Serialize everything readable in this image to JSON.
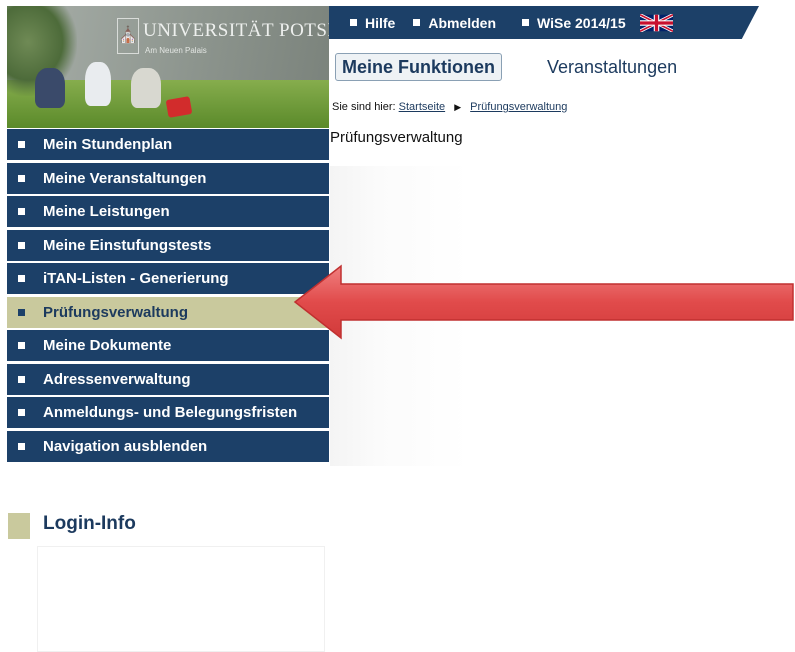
{
  "header": {
    "university_name": "UNIVERSITÄT POTSDAM",
    "university_sub": "Am Neuen Palais"
  },
  "topbar": {
    "help": "Hilfe",
    "logout": "Abmelden",
    "semester": "WiSe 2014/15",
    "language_icon": "uk-flag-icon"
  },
  "tabs": {
    "active": "Meine Funktionen",
    "other": "Veranstaltungen"
  },
  "breadcrumb": {
    "prefix": "Sie sind hier:",
    "home": "Startseite",
    "current": "Prüfungsverwaltung"
  },
  "page_title": "Prüfungsverwaltung",
  "sidebar": {
    "items": [
      {
        "label": "Mein Stundenplan"
      },
      {
        "label": "Meine Veranstaltungen"
      },
      {
        "label": "Meine Leistungen"
      },
      {
        "label": "Meine Einstufungstests"
      },
      {
        "label": "iTAN-Listen - Generierung"
      },
      {
        "label": "Prüfungsverwaltung",
        "active": true
      },
      {
        "label": "Meine Dokumente"
      },
      {
        "label": "Adressenverwaltung"
      },
      {
        "label": "Anmeldungs- und Belegungsfristen"
      },
      {
        "label": "Navigation ausblenden"
      }
    ]
  },
  "login_info": {
    "title": "Login-Info"
  },
  "colors": {
    "nav_blue": "#1c4068",
    "active_khaki": "#c9c99d",
    "annotation_arrow": "#e14b4b"
  }
}
